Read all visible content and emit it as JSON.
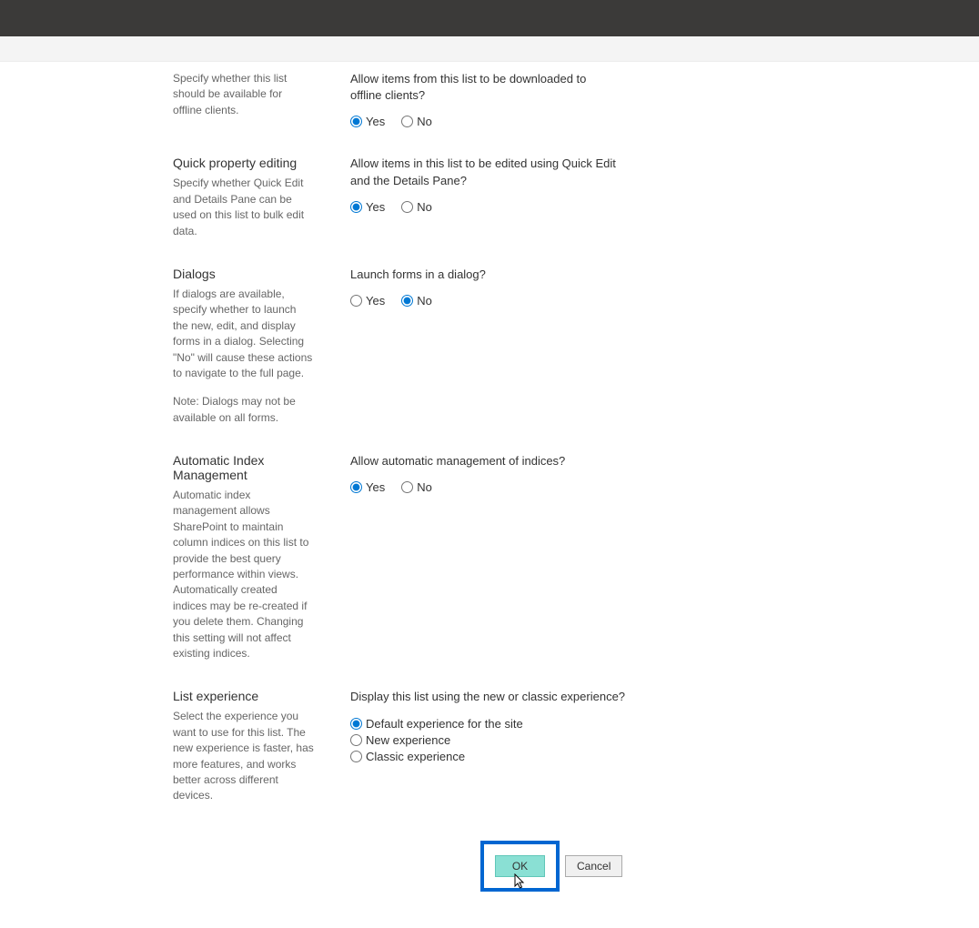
{
  "options": {
    "yes": "Yes",
    "no": "No"
  },
  "offline": {
    "desc": "Specify whether this list should be available for offline clients.",
    "question": "Allow items from this list to be downloaded to offline clients?"
  },
  "quickedit": {
    "title": "Quick property editing",
    "desc": "Specify whether Quick Edit and Details Pane can be used on this list to bulk edit data.",
    "question": "Allow items in this list to be edited using Quick Edit and the Details Pane?"
  },
  "dialogs": {
    "title": "Dialogs",
    "desc": "If dialogs are available, specify whether to launch the new, edit, and display forms in a dialog. Selecting \"No\" will cause these actions to navigate to the full page.",
    "note": "Note: Dialogs may not be available on all forms.",
    "question": "Launch forms in a dialog?"
  },
  "autoindex": {
    "title": "Automatic Index Management",
    "desc": "Automatic index management allows SharePoint to maintain column indices on this list to provide the best query performance within views. Automatically created indices may be re-created if you delete them. Changing this setting will not affect existing indices.",
    "question": "Allow automatic management of indices?"
  },
  "experience": {
    "title": "List experience",
    "desc": "Select the experience you want to use for this list. The new experience is faster, has more features, and works better across different devices.",
    "question": "Display this list using the new or classic experience?",
    "opt_default": "Default experience for the site",
    "opt_new": "New experience",
    "opt_classic": "Classic experience"
  },
  "buttons": {
    "ok": "OK",
    "cancel": "Cancel"
  }
}
